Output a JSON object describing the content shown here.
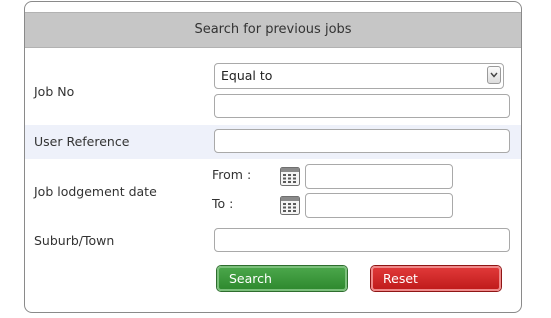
{
  "header": {
    "title": "Search for previous jobs"
  },
  "job_no": {
    "label": "Job No",
    "operator_selected": "Equal to",
    "value": ""
  },
  "user_reference": {
    "label": "User Reference",
    "value": ""
  },
  "lodgement_date": {
    "label": "Job lodgement date",
    "from_label": "From :",
    "to_label": "To :",
    "from_value": "",
    "to_value": "",
    "icon": "calendar-icon"
  },
  "suburb": {
    "label": "Suburb/Town",
    "value": ""
  },
  "buttons": {
    "search_label": "Search",
    "reset_label": "Reset"
  },
  "colors": {
    "header_bg": "#c6c6c6",
    "highlight_row": "#eef1fa",
    "search_button": "#3a983a",
    "reset_button": "#d02a2a"
  }
}
